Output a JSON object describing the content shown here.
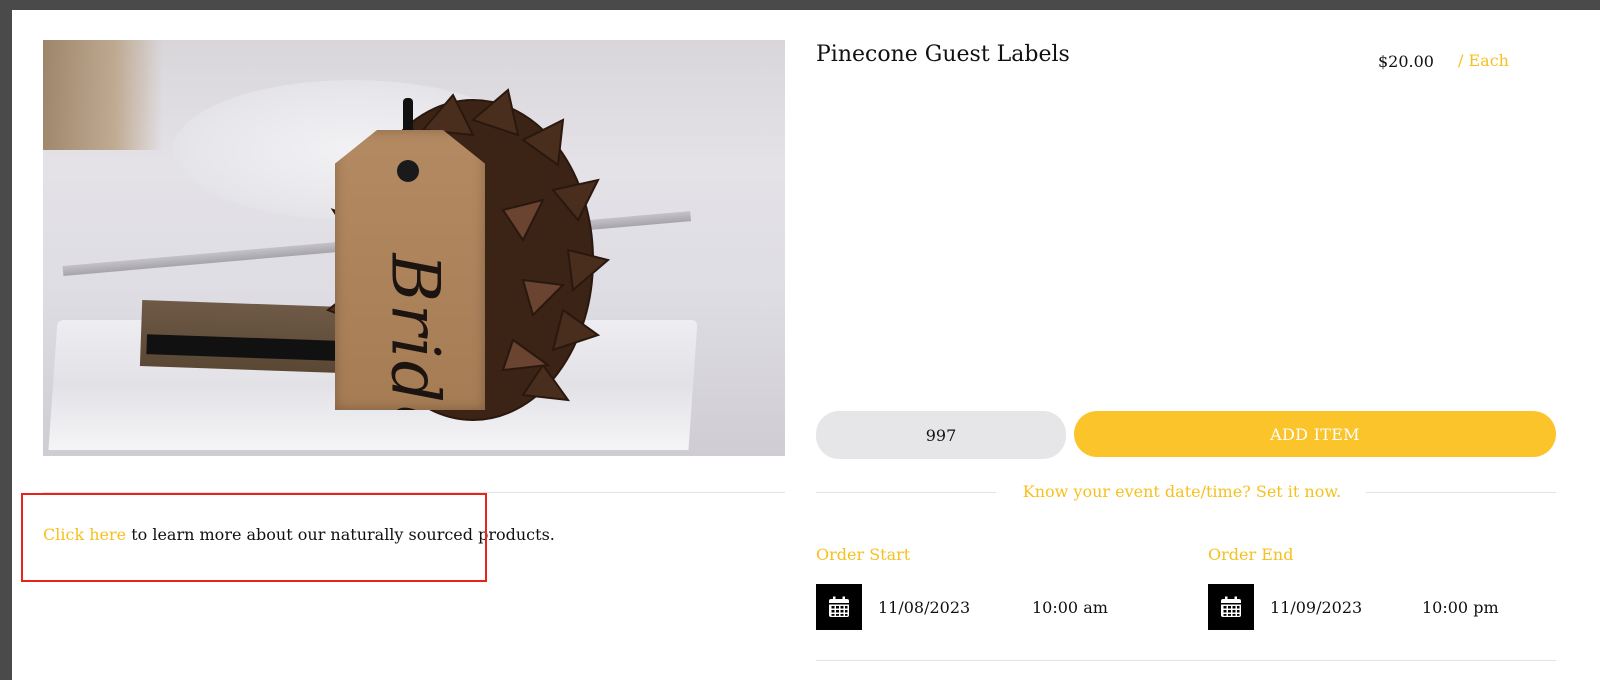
{
  "product": {
    "title": "Pinecone Guest Labels",
    "price": "$20.00",
    "unit": "/ Each",
    "image_alt": "Pinecone with kraft tag",
    "tag_text": "Bride"
  },
  "order": {
    "quantity": "997",
    "add_label": "ADD ITEM",
    "event_prompt": "Know your event date/time? Set it now.",
    "start": {
      "label": "Order Start",
      "date": "11/08/2023",
      "time": "10:00 am"
    },
    "end": {
      "label": "Order End",
      "date": "11/09/2023",
      "time": "10:00 pm"
    }
  },
  "info": {
    "link_text": "Click here",
    "rest_text": " to learn more about our naturally sourced products."
  },
  "colors": {
    "accent": "#fbc42a",
    "link": "#f6c11f",
    "highlight_box": "#e8231b",
    "qty_bg": "#e6e6e8"
  },
  "icons": {
    "calendar": "calendar-icon"
  }
}
